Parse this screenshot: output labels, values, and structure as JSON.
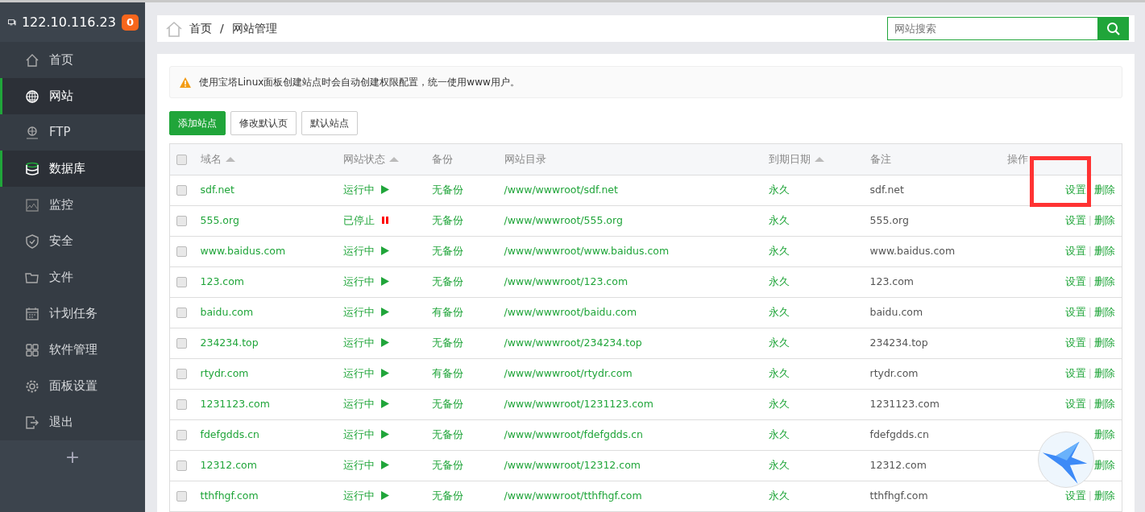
{
  "sidebar": {
    "host": "122.10.116.23",
    "badge": "0",
    "items": [
      {
        "label": "首页",
        "selected": false
      },
      {
        "label": "网站",
        "selected": true
      },
      {
        "label": "FTP",
        "selected": false
      },
      {
        "label": "数据库",
        "selected": true
      },
      {
        "label": "监控",
        "selected": false
      },
      {
        "label": "安全",
        "selected": false
      },
      {
        "label": "文件",
        "selected": false
      },
      {
        "label": "计划任务",
        "selected": false
      },
      {
        "label": "软件管理",
        "selected": false
      },
      {
        "label": "面板设置",
        "selected": false
      },
      {
        "label": "退出",
        "selected": false
      }
    ],
    "add": "+"
  },
  "breadcrumb": [
    "首页",
    "网站管理"
  ],
  "breadcrumb_separator": "/",
  "search": {
    "placeholder": "网站搜索"
  },
  "notice": "使用宝塔Linux面板创建站点时会自动创建权限配置，统一使用www用户。",
  "buttons": [
    {
      "label": "添加站点",
      "kind": "primary"
    },
    {
      "label": "修改默认页",
      "kind": "plain"
    },
    {
      "label": "默认站点",
      "kind": "plain"
    }
  ],
  "table": {
    "all_checked": false,
    "link_separator": "|",
    "columns": [
      {
        "label": "域名",
        "sortable": true
      },
      {
        "label": "网站状态",
        "sortable": true
      },
      {
        "label": "备份",
        "sortable": false
      },
      {
        "label": "网站目录",
        "sortable": false
      },
      {
        "label": "到期日期",
        "sortable": true
      },
      {
        "label": "备注",
        "sortable": false
      },
      {
        "label": "操作",
        "sortable": false
      }
    ],
    "rows": [
      {
        "domain": "sdf.net",
        "status": "运行中",
        "running": true,
        "backup": "无备份",
        "path": "/www/wwwroot/sdf.net",
        "expiry": "永久",
        "note": "sdf.net",
        "settings": "设置",
        "delete": "删除",
        "highlighted": true,
        "checked": false
      },
      {
        "domain": "555.org",
        "status": "已停止",
        "running": false,
        "backup": "无备份",
        "path": "/www/wwwroot/555.org",
        "expiry": "永久",
        "note": "555.org",
        "settings": "设置",
        "delete": "删除",
        "highlighted": false,
        "checked": false
      },
      {
        "domain": "www.baidus.com",
        "status": "运行中",
        "running": true,
        "backup": "无备份",
        "path": "/www/wwwroot/www.baidus.com",
        "expiry": "永久",
        "note": "www.baidus.com",
        "settings": "设置",
        "delete": "删除",
        "highlighted": false,
        "checked": false
      },
      {
        "domain": "123.com",
        "status": "运行中",
        "running": true,
        "backup": "无备份",
        "path": "/www/wwwroot/123.com",
        "expiry": "永久",
        "note": "123.com",
        "settings": "设置",
        "delete": "删除",
        "highlighted": false,
        "checked": false
      },
      {
        "domain": "baidu.com",
        "status": "运行中",
        "running": true,
        "backup": "有备份",
        "path": "/www/wwwroot/baidu.com",
        "expiry": "永久",
        "note": "baidu.com",
        "settings": "设置",
        "delete": "删除",
        "highlighted": false,
        "checked": false
      },
      {
        "domain": "234234.top",
        "status": "运行中",
        "running": true,
        "backup": "无备份",
        "path": "/www/wwwroot/234234.top",
        "expiry": "永久",
        "note": "234234.top",
        "settings": "设置",
        "delete": "删除",
        "highlighted": false,
        "checked": false
      },
      {
        "domain": "rtydr.com",
        "status": "运行中",
        "running": true,
        "backup": "有备份",
        "path": "/www/wwwroot/rtydr.com",
        "expiry": "永久",
        "note": "rtydr.com",
        "settings": "设置",
        "delete": "删除",
        "highlighted": false,
        "checked": false
      },
      {
        "domain": "1231123.com",
        "status": "运行中",
        "running": true,
        "backup": "无备份",
        "path": "/www/wwwroot/1231123.com",
        "expiry": "永久",
        "note": "1231123.com",
        "settings": "设置",
        "delete": "删除",
        "highlighted": false,
        "checked": false
      },
      {
        "domain": "fdefgdds.cn",
        "status": "运行中",
        "running": true,
        "backup": "无备份",
        "path": "/www/wwwroot/fdefgdds.cn",
        "expiry": "永久",
        "note": "fdefgdds.cn",
        "delete": "删除",
        "highlighted": false,
        "checked": false
      },
      {
        "domain": "12312.com",
        "status": "运行中",
        "running": true,
        "backup": "无备份",
        "path": "/www/wwwroot/12312.com",
        "expiry": "永久",
        "note": "12312.com",
        "delete": "删除",
        "highlighted": false,
        "checked": false
      },
      {
        "domain": "tthfhgf.com",
        "status": "运行中",
        "running": true,
        "backup": "无备份",
        "path": "/www/wwwroot/tthfhgf.com",
        "expiry": "永久",
        "note": "tthfhgf.com",
        "settings": "设置",
        "delete": "删除",
        "highlighted": false,
        "checked": false
      }
    ]
  }
}
